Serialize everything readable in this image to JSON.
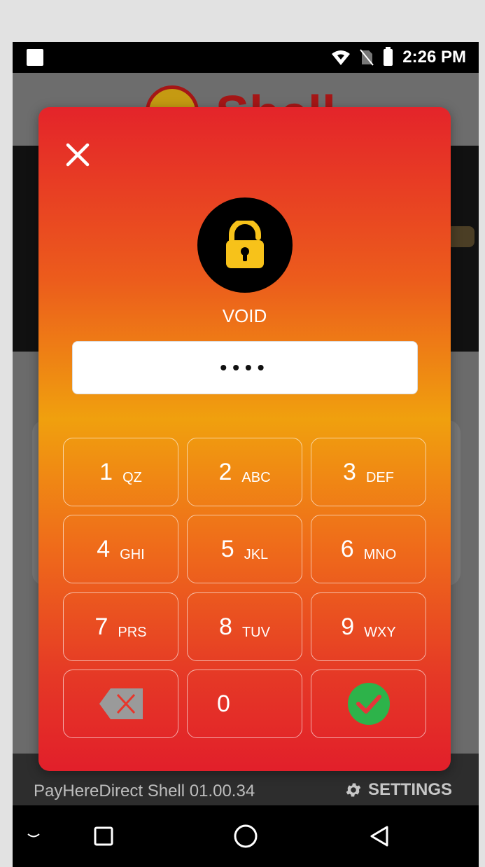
{
  "status_bar": {
    "time": "2:26 PM"
  },
  "background_app": {
    "brand": "Shell",
    "version": "PayHereDirect Shell 01.00.34",
    "settings_label": "SETTINGS"
  },
  "dialog": {
    "title": "VOID",
    "pin_value": "••••",
    "keys": [
      {
        "digit": "1",
        "letters": "QZ"
      },
      {
        "digit": "2",
        "letters": "ABC"
      },
      {
        "digit": "3",
        "letters": "DEF"
      },
      {
        "digit": "4",
        "letters": "GHI"
      },
      {
        "digit": "5",
        "letters": "JKL"
      },
      {
        "digit": "6",
        "letters": "MNO"
      },
      {
        "digit": "7",
        "letters": "PRS"
      },
      {
        "digit": "8",
        "letters": "TUV"
      },
      {
        "digit": "9",
        "letters": "WXY"
      },
      {
        "digit": "0",
        "letters": ""
      }
    ],
    "icons": {
      "close": "close-icon",
      "lock": "lock-open-icon",
      "backspace": "backspace-icon",
      "confirm": "check-icon"
    }
  },
  "colors": {
    "lock_yellow": "#f7c21a",
    "confirm_green": "#2db34a",
    "backspace_gray": "#9a9a9a",
    "backspace_x": "#e8362b"
  }
}
